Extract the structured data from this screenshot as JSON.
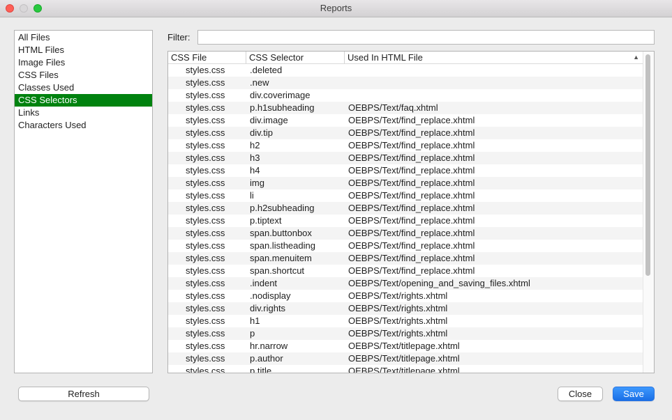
{
  "window": {
    "title": "Reports"
  },
  "sidebar": {
    "items": [
      {
        "label": "All Files"
      },
      {
        "label": "HTML Files"
      },
      {
        "label": "Image Files"
      },
      {
        "label": "CSS Files"
      },
      {
        "label": "Classes Used"
      },
      {
        "label": "CSS Selectors",
        "selected": true
      },
      {
        "label": "Links"
      },
      {
        "label": "Characters Used"
      }
    ],
    "selected_color": "#00820f"
  },
  "filter": {
    "label": "Filter:",
    "value": ""
  },
  "table": {
    "columns": [
      "CSS File",
      "CSS Selector",
      "Used In HTML File"
    ],
    "sort_indicator": "ascending",
    "rows": [
      [
        "styles.css",
        ".deleted",
        ""
      ],
      [
        "styles.css",
        ".new",
        ""
      ],
      [
        "styles.css",
        "div.coverimage",
        ""
      ],
      [
        "styles.css",
        "p.h1subheading",
        "OEBPS/Text/faq.xhtml"
      ],
      [
        "styles.css",
        "div.image",
        "OEBPS/Text/find_replace.xhtml"
      ],
      [
        "styles.css",
        "div.tip",
        "OEBPS/Text/find_replace.xhtml"
      ],
      [
        "styles.css",
        "h2",
        "OEBPS/Text/find_replace.xhtml"
      ],
      [
        "styles.css",
        "h3",
        "OEBPS/Text/find_replace.xhtml"
      ],
      [
        "styles.css",
        "h4",
        "OEBPS/Text/find_replace.xhtml"
      ],
      [
        "styles.css",
        "img",
        "OEBPS/Text/find_replace.xhtml"
      ],
      [
        "styles.css",
        "li",
        "OEBPS/Text/find_replace.xhtml"
      ],
      [
        "styles.css",
        "p.h2subheading",
        "OEBPS/Text/find_replace.xhtml"
      ],
      [
        "styles.css",
        "p.tiptext",
        "OEBPS/Text/find_replace.xhtml"
      ],
      [
        "styles.css",
        "span.buttonbox",
        "OEBPS/Text/find_replace.xhtml"
      ],
      [
        "styles.css",
        "span.listheading",
        "OEBPS/Text/find_replace.xhtml"
      ],
      [
        "styles.css",
        "span.menuitem",
        "OEBPS/Text/find_replace.xhtml"
      ],
      [
        "styles.css",
        "span.shortcut",
        "OEBPS/Text/find_replace.xhtml"
      ],
      [
        "styles.css",
        ".indent",
        "OEBPS/Text/opening_and_saving_files.xhtml"
      ],
      [
        "styles.css",
        ".nodisplay",
        "OEBPS/Text/rights.xhtml"
      ],
      [
        "styles.css",
        "div.rights",
        "OEBPS/Text/rights.xhtml"
      ],
      [
        "styles.css",
        "h1",
        "OEBPS/Text/rights.xhtml"
      ],
      [
        "styles.css",
        "p",
        "OEBPS/Text/rights.xhtml"
      ],
      [
        "styles.css",
        "hr.narrow",
        "OEBPS/Text/titlepage.xhtml"
      ],
      [
        "styles.css",
        "p.author",
        "OEBPS/Text/titlepage.xhtml"
      ],
      [
        "styles.css",
        "p.title",
        "OEBPS/Text/titlepage.xhtml"
      ]
    ]
  },
  "buttons": {
    "refresh": "Refresh",
    "close": "Close",
    "save": "Save"
  },
  "colors": {
    "accent": "#1a6fe6",
    "close_button": "#fe5f57",
    "zoom_button": "#28c840"
  }
}
